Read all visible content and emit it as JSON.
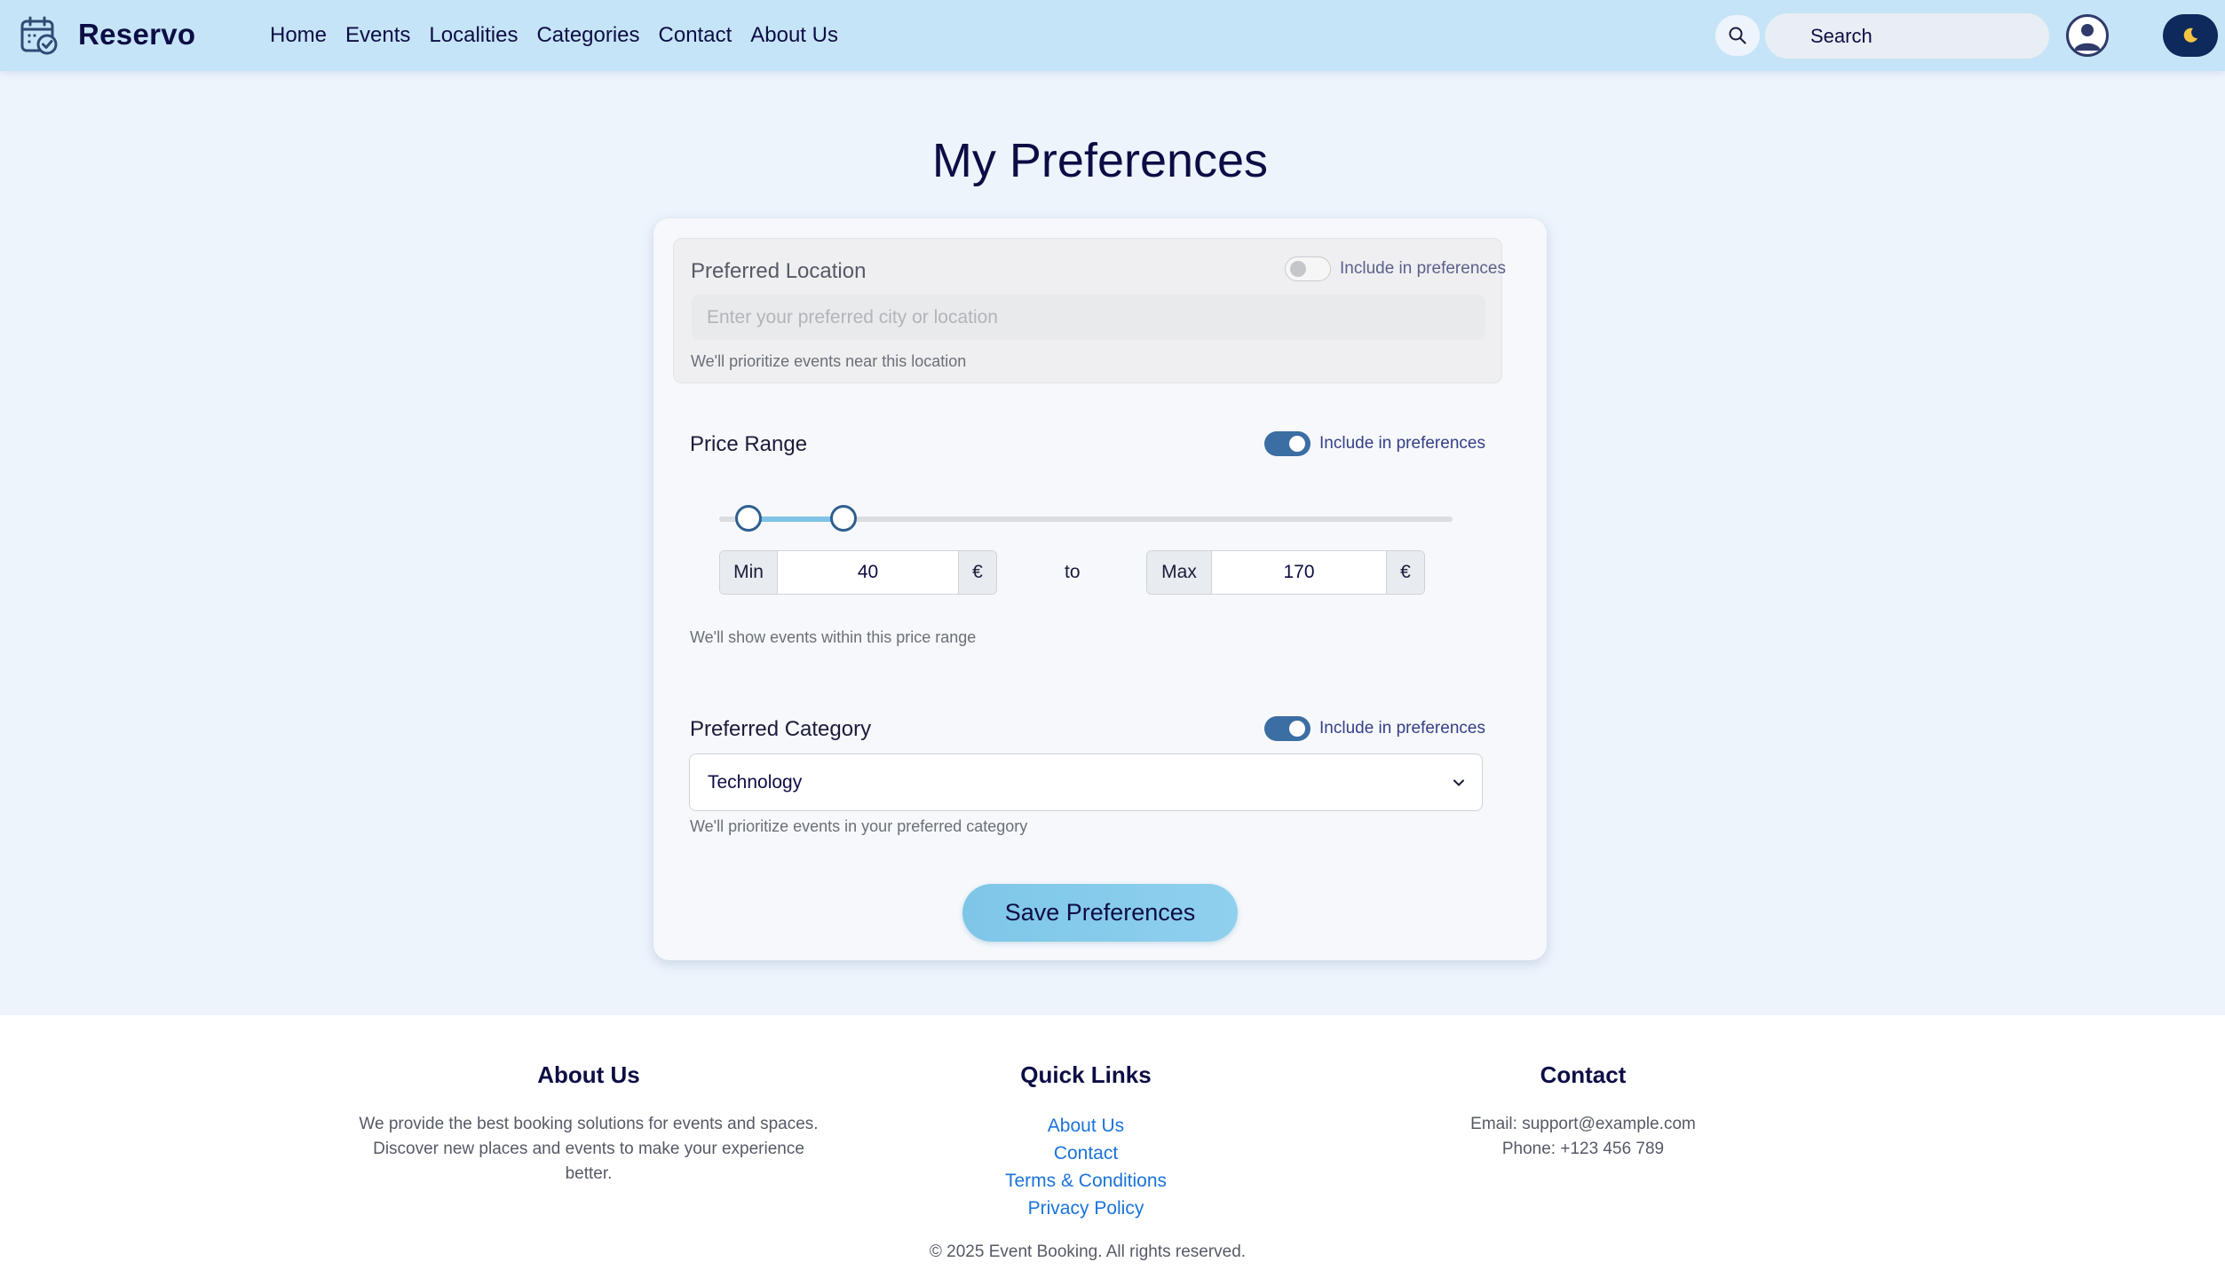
{
  "navbar": {
    "brand": "Reservo",
    "links": [
      "Home",
      "Events",
      "Localities",
      "Categories",
      "Contact",
      "About Us"
    ],
    "search_label": "Search",
    "theme_icon": "moon-icon",
    "colors": {
      "bar": "#c6e4f7",
      "brand": "#0d0d45"
    }
  },
  "page": {
    "title": "My Preferences"
  },
  "location": {
    "label": "Preferred Location",
    "include_label": "Include in preferences",
    "include_enabled": false,
    "placeholder": "Enter your preferred city or location",
    "value": "",
    "help": "We'll prioritize events near this location"
  },
  "price": {
    "label": "Price Range",
    "include_label": "Include in preferences",
    "include_enabled": true,
    "min_label": "Min",
    "min_value": "40",
    "max_label": "Max",
    "max_value": "170",
    "currency": "€",
    "to_label": "to",
    "slider_min_fraction": 0.04,
    "slider_max_fraction": 0.17,
    "help": "We'll show events within this price range"
  },
  "category": {
    "label": "Preferred Category",
    "include_label": "Include in preferences",
    "include_enabled": true,
    "selected": "Technology",
    "help": "We'll prioritize events in your preferred category"
  },
  "save_label": "Save Preferences",
  "footer": {
    "about": {
      "heading": "About Us",
      "lines": [
        "We provide the best booking solutions for events and spaces.",
        "Discover new places and events to make your experience",
        "better."
      ]
    },
    "quick_links": {
      "heading": "Quick Links",
      "links": [
        "About Us",
        "Contact",
        "Terms & Conditions",
        "Privacy Policy"
      ]
    },
    "contact": {
      "heading": "Contact",
      "email": "Email: support@example.com",
      "phone": "Phone: +123 456 789"
    },
    "copyright": "© 2025 Event Booking. All rights reserved."
  }
}
